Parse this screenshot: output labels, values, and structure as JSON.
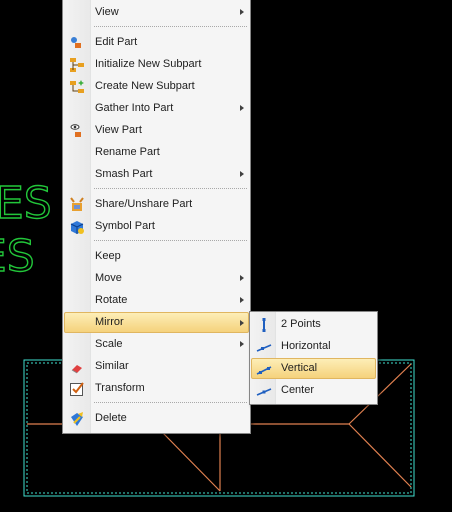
{
  "background": {
    "text_line_1": "ES",
    "text_line_2": "IES",
    "colors": {
      "canvas": "#000000",
      "text": "#22c63a",
      "frame": "#40e0d0",
      "lines": "#e08050"
    }
  },
  "context_menu": {
    "items": [
      {
        "label": "View",
        "icon": "",
        "submenu": true
      },
      {
        "label": "Edit Part",
        "icon": "edit-part-icon",
        "submenu": false
      },
      {
        "label": "Initialize New Subpart",
        "icon": "initialize-subpart-icon",
        "submenu": false
      },
      {
        "label": "Create New Subpart",
        "icon": "create-subpart-icon",
        "submenu": false
      },
      {
        "label": "Gather Into Part",
        "icon": "",
        "submenu": true
      },
      {
        "label": "View Part",
        "icon": "view-part-icon",
        "submenu": false
      },
      {
        "label": "Rename Part",
        "icon": "",
        "submenu": false
      },
      {
        "label": "Smash Part",
        "icon": "",
        "submenu": true
      },
      {
        "label": "Share/Unshare Part",
        "icon": "share-part-icon",
        "submenu": false
      },
      {
        "label": "Symbol Part",
        "icon": "symbol-part-icon",
        "submenu": false
      },
      {
        "label": "Keep",
        "icon": "",
        "submenu": false
      },
      {
        "label": "Move",
        "icon": "",
        "submenu": true
      },
      {
        "label": "Rotate",
        "icon": "",
        "submenu": true
      },
      {
        "label": "Mirror",
        "icon": "",
        "submenu": true
      },
      {
        "label": "Scale",
        "icon": "",
        "submenu": true
      },
      {
        "label": "Similar",
        "icon": "similar-icon",
        "submenu": false
      },
      {
        "label": "Transform",
        "icon": "transform-icon",
        "submenu": false
      },
      {
        "label": "Delete",
        "icon": "delete-icon",
        "submenu": false
      }
    ],
    "highlighted": "Mirror"
  },
  "mirror_submenu": {
    "items": [
      {
        "label": "2 Points",
        "icon": "two-points-icon"
      },
      {
        "label": "Horizontal",
        "icon": "horizontal-mirror-icon"
      },
      {
        "label": "Vertical",
        "icon": "vertical-mirror-icon"
      },
      {
        "label": "Center",
        "icon": "center-mirror-icon"
      }
    ],
    "highlighted": "Vertical"
  }
}
